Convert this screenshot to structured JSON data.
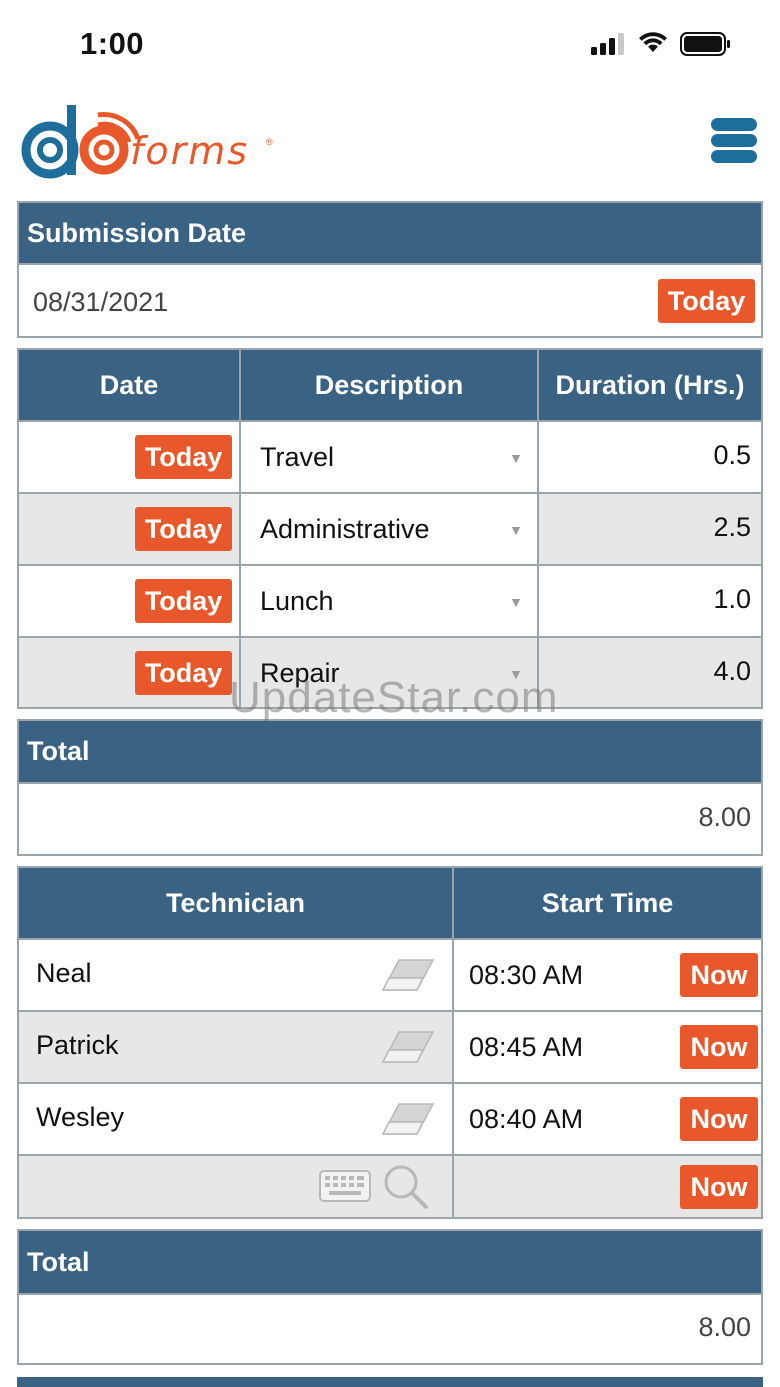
{
  "status_bar": {
    "time": "1:00"
  },
  "brand": {
    "logo_text": "forms",
    "reg_mark": "®",
    "accent_color": "#e8582a",
    "primary_color": "#1d6e9a"
  },
  "submission": {
    "header": "Submission Date",
    "value": "08/31/2021",
    "today_label": "Today"
  },
  "activity_table": {
    "columns": [
      "Date",
      "Description",
      "Duration (Hrs.)"
    ],
    "rows": [
      {
        "date_btn": "Today",
        "description": "Travel",
        "duration": "0.5"
      },
      {
        "date_btn": "Today",
        "description": "Administrative",
        "duration": "2.5"
      },
      {
        "date_btn": "Today",
        "description": "Lunch",
        "duration": "1.0"
      },
      {
        "date_btn": "Today",
        "description": "Repair",
        "duration": "4.0"
      }
    ]
  },
  "total1": {
    "header": "Total",
    "value": "8.00"
  },
  "tech_table": {
    "columns": [
      "Technician",
      "Start Time"
    ],
    "rows": [
      {
        "name": "Neal",
        "start": "08:30 AM",
        "now_label": "Now"
      },
      {
        "name": "Patrick",
        "start": "08:45 AM",
        "now_label": "Now"
      },
      {
        "name": "Wesley",
        "start": "08:40 AM",
        "now_label": "Now"
      },
      {
        "name": "",
        "start": "",
        "now_label": "Now"
      }
    ]
  },
  "total2": {
    "header": "Total",
    "value": "8.00"
  },
  "watermark": "UpdateStar.com",
  "icons": [
    "signal-icon",
    "wifi-icon",
    "battery-icon",
    "menu-icon",
    "eraser-icon",
    "keyboard-icon",
    "search-icon",
    "dropdown-caret-icon"
  ]
}
